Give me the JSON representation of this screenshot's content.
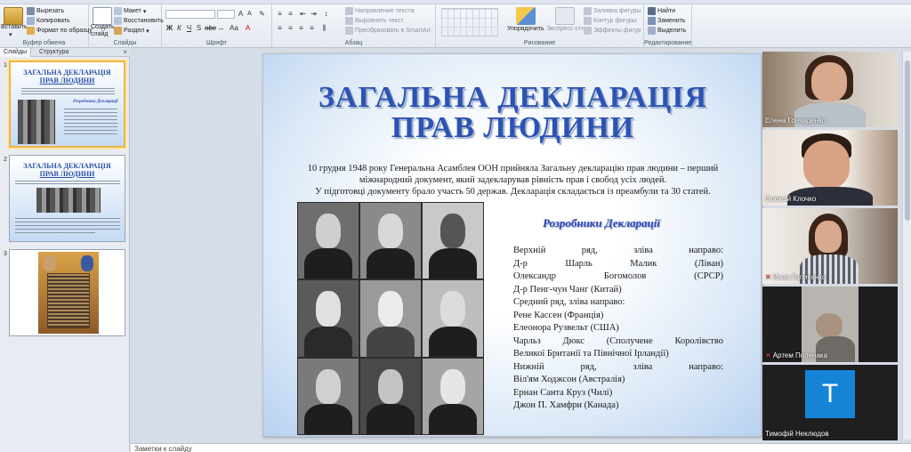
{
  "ribbon": {
    "clipboard": {
      "paste": "Вставить",
      "cut": "Вырезать",
      "copy": "Копировать",
      "format_painter": "Формат по образцу",
      "label": "Буфер обмена"
    },
    "slides": {
      "new_slide": "Создать слайд",
      "layout": "Макет",
      "reset": "Восстановить",
      "section": "Раздел",
      "label": "Слайды"
    },
    "font": {
      "label": "Шрифт"
    },
    "paragraph": {
      "text_direction": "Направление текста",
      "align_text": "Выровнять текст",
      "smartart": "Преобразовать в SmartArt",
      "label": "Абзац"
    },
    "drawing": {
      "arrange": "Упорядочить",
      "quick_styles": "Экспресс-стили",
      "shape_fill": "Заливка фигуры",
      "shape_outline": "Контур фигуры",
      "shape_effects": "Эффекты фигур",
      "label": "Рисование"
    },
    "editing": {
      "find": "Найти",
      "replace": "Заменить",
      "select": "Выделить",
      "label": "Редактирование"
    }
  },
  "left_panel": {
    "tabs": [
      "Слайды",
      "Структура"
    ],
    "close": "×",
    "slides": [
      {
        "num": "1",
        "title_line1": "ЗАГАЛЬНА ДЕКЛАРАЦІЯ",
        "title_line2": "ПРАВ ЛЮДИНИ",
        "sub": "Розробники Декларації"
      },
      {
        "num": "2",
        "title_line1": "ЗАГАЛЬНА ДЕКЛАРАЦІЯ",
        "title_line2": "ПРАВ ЛЮДИНИ"
      },
      {
        "num": "3"
      }
    ]
  },
  "slide": {
    "title_line1": "ЗАГАЛЬНА ДЕКЛАРАЦІЯ",
    "title_line2": "ПРАВ ЛЮДИНИ",
    "intro_line1": "10 грудня 1948 року Генеральна Асамблея ООН прийняла Загальну декларацію прав людини – перший",
    "intro_line2": "міжнародний документ, який задекларував рівність прав і свобод усіх людей.",
    "intro_line3": "У підготовці документу брало участь 50 держав. Декларація складається із преамбули та 30 статей.",
    "developers_heading": "Розробники Декларації",
    "developers": [
      "Верхній ряд, зліва направо:",
      "Д-р Шарль Малик (Ліван)",
      "Олександр Богомолов (СРСР)",
      "Д-р Пенг-чун Чанг (Китай)",
      "Средний ряд, зліва направо:",
      "Рене Кассен (Франція)",
      "Елеонора Рузвельт (США)",
      "Чарльз Дюкс (Сполучене Королівство",
      "Великої Британії та Північної Ірландії)",
      "Нижній ряд, зліва направо:",
      "Віл'ям Ходжсон (Австралія)",
      "Ернан Санта Круз (Чилі)",
      "Джон П. Хамфри (Канада)"
    ]
  },
  "video": {
    "participants": [
      {
        "name": "Елена Гончаренко",
        "muted": false
      },
      {
        "name": "Олексій Клочко",
        "muted": false,
        "active": true
      },
      {
        "name": "Инна Галиченко",
        "muted": true
      },
      {
        "name": "Артем Попенака",
        "muted": true
      },
      {
        "name": "Тимофій Неклюдов",
        "muted": false,
        "avatar": "T"
      }
    ]
  },
  "notes": {
    "placeholder": "Заметки к слайду"
  },
  "colors": {
    "title_blue": "#2c53b4",
    "active_speaker": "#5bd35b",
    "avatar_blue": "#1583d6",
    "selected_thumb": "#f0b540"
  }
}
